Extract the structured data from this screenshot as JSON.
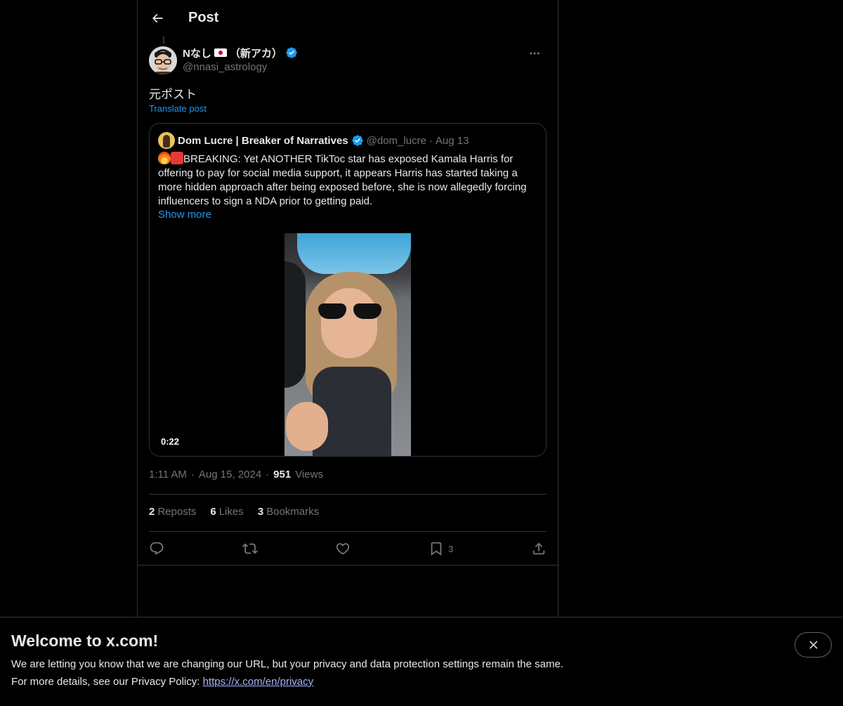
{
  "header": {
    "title": "Post"
  },
  "post": {
    "author": {
      "display_name": "Nなし",
      "display_name_suffix": "（新アカ）",
      "handle": "@nnasi_astrology",
      "flag_icon": "japan-flag-icon"
    },
    "text": "元ポスト",
    "translate_label": "Translate post",
    "quote": {
      "display_name": "Dom Lucre | Breaker of Narratives",
      "handle": "@dom_lucre",
      "separator": "·",
      "date": "Aug 13",
      "text": "BREAKING: Yet ANOTHER TikToc star has exposed Kamala Harris for offering to pay for social media support, it appears Harris has started taking a more hidden approach after being exposed before, she is now allegedly forcing influencers to sign a NDA prior to getting paid.",
      "show_more_label": "Show more",
      "video_duration": "0:22"
    },
    "meta": {
      "time": "1:11 AM",
      "sep1": "·",
      "date": "Aug 15, 2024",
      "sep2": "·",
      "views_count": "951",
      "views_label": "Views"
    },
    "stats": {
      "reposts_count": "2",
      "reposts_label": "Reposts",
      "likes_count": "6",
      "likes_label": "Likes",
      "bookmarks_count": "3",
      "bookmarks_label": "Bookmarks"
    },
    "actions": {
      "bookmark_count": "3"
    }
  },
  "banner": {
    "title": "Welcome to x.com!",
    "line1": "We are letting you know that we are changing our URL, but your privacy and data protection settings remain the same.",
    "line2_prefix": "For more details, see our Privacy Policy: ",
    "link": "https://x.com/en/privacy"
  },
  "colors": {
    "background": "#000000",
    "text_primary": "#e7e9ea",
    "text_secondary": "#71767b",
    "accent": "#1d9bf0",
    "border": "#2f3336",
    "verified": "#1d9bf0"
  }
}
